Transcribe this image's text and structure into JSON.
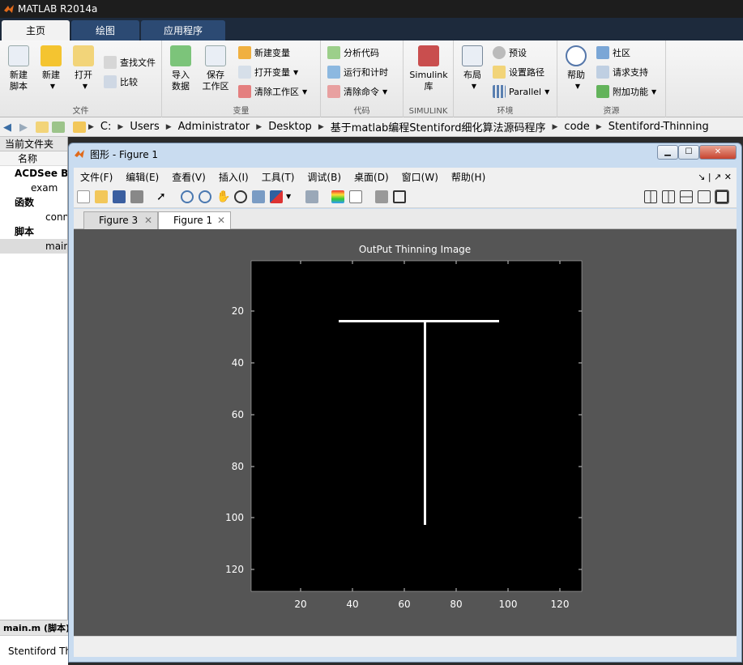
{
  "app": {
    "title": "MATLAB R2014a"
  },
  "ribbon": {
    "tabs": [
      "主页",
      "绘图",
      "应用程序"
    ],
    "groups": {
      "file": {
        "label": "文件",
        "new_script": "新建\n脚本",
        "new": "新建",
        "open": "打开",
        "find_files": "查找文件",
        "compare": "比较"
      },
      "variable": {
        "label": "变量",
        "import": "导入\n数据",
        "save_ws": "保存\n工作区",
        "new_var": "新建变量",
        "open_var": "打开变量",
        "clear_ws": "清除工作区"
      },
      "code": {
        "label": "代码",
        "analyze": "分析代码",
        "run_time": "运行和计时",
        "clear_cmd": "清除命令"
      },
      "simulink": {
        "label": "SIMULINK",
        "lib": "Simulink\n库"
      },
      "env": {
        "label": "环境",
        "layout": "布局",
        "prefs": "预设",
        "set_path": "设置路径",
        "parallel": "Parallel"
      },
      "resources": {
        "label": "资源",
        "help": "帮助",
        "community": "社区",
        "support": "请求支持",
        "addons": "附加功能"
      }
    }
  },
  "address": {
    "path": [
      "C:",
      "Users",
      "Administrator",
      "Desktop",
      "基于matlab编程Stentiford细化算法源码程序",
      "code",
      "Stentiford-Thinning"
    ]
  },
  "left_panel": {
    "header": "当前文件夹",
    "column": "名称",
    "rows": [
      {
        "label": "ACDSee BI",
        "bold": true
      },
      {
        "label": "exam",
        "bold": false
      },
      {
        "label": "函数",
        "bold": true
      },
      {
        "label": "conn",
        "bold": false
      },
      {
        "label": "脚本",
        "bold": true
      },
      {
        "label": "main",
        "bold": false
      }
    ],
    "detail_title": "main.m (脚本)",
    "detail_text": "Stentiford Th"
  },
  "figure": {
    "title": "图形 - Figure 1",
    "menu": [
      "文件(F)",
      "编辑(E)",
      "查看(V)",
      "插入(I)",
      "工具(T)",
      "调试(B)",
      "桌面(D)",
      "窗口(W)",
      "帮助(H)"
    ],
    "tabs": [
      "Figure 3",
      "Figure 1"
    ],
    "axes": {
      "title": "OutPut Thinning Image",
      "xticks": [
        "20",
        "40",
        "60",
        "80",
        "100",
        "120"
      ],
      "yticks": [
        "20",
        "40",
        "60",
        "80",
        "100",
        "120"
      ]
    }
  },
  "colors": {
    "plot_bg": "#555555",
    "axes_bg": "#000000",
    "line": "#ffffff",
    "ribbon_tab_bar": "#1d2a3c"
  }
}
